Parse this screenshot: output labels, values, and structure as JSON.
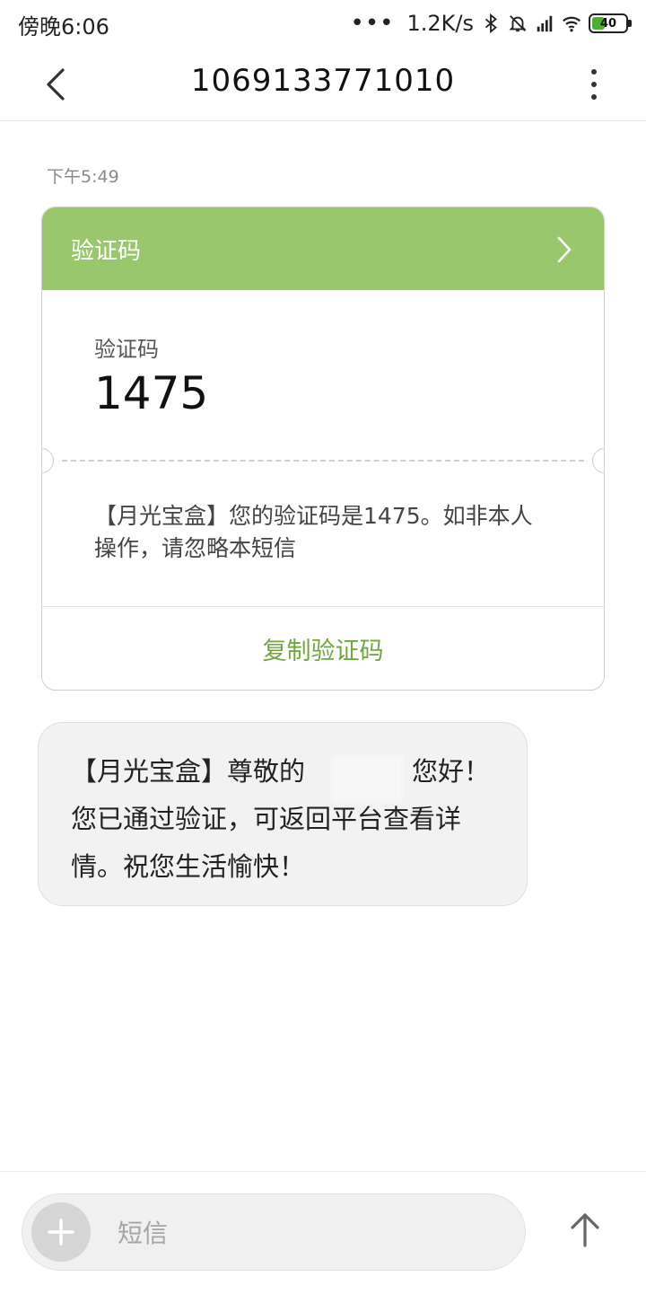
{
  "status_bar": {
    "time": "傍晚6:06",
    "dots": "•••",
    "network_speed": "1.2K/s",
    "battery": "40",
    "battery_level": 0.4
  },
  "header": {
    "title": "1069133771010"
  },
  "messages": {
    "time": "下午5:49",
    "card": {
      "header_label": "验证码",
      "code_label": "验证码",
      "code": "1475",
      "body": "【月光宝盒】您的验证码是1475。如非本人操作，请忽略本短信",
      "copy_button": "复制验证码"
    },
    "bubble": {
      "text_part1": "【月光宝盒】尊敬的",
      "text_part2": "，您好！您已通过验证，可返回平台查看详情。祝您生活愉快！"
    }
  },
  "input_bar": {
    "placeholder": "短信"
  },
  "colors": {
    "card_header": "#98c76c",
    "copy_text": "#6fa93e"
  }
}
